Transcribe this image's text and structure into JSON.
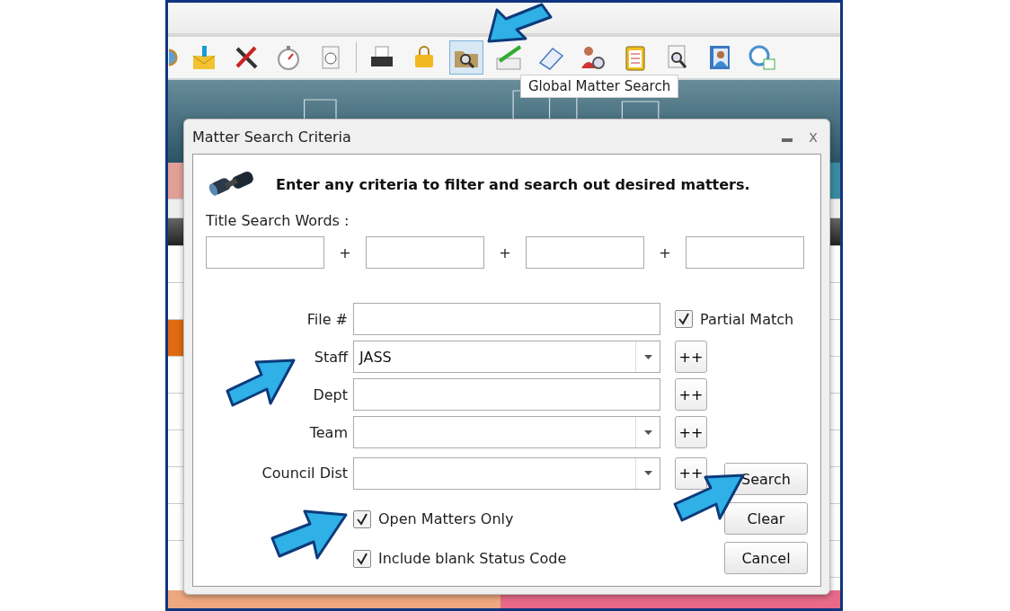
{
  "toolbar": [
    {
      "kind": "globe",
      "selected": false
    },
    {
      "kind": "mail",
      "selected": false
    },
    {
      "kind": "tools",
      "selected": false
    },
    {
      "kind": "stopwatch",
      "selected": false
    },
    {
      "kind": "clockdoc",
      "selected": false
    },
    {
      "kind": "printer",
      "selected": false
    },
    {
      "kind": "lock",
      "selected": false
    },
    {
      "kind": "foldersearch",
      "selected": true
    },
    {
      "kind": "pen",
      "selected": false
    },
    {
      "kind": "notepad",
      "selected": false
    },
    {
      "kind": "people",
      "selected": false
    },
    {
      "kind": "clipboard",
      "selected": false
    },
    {
      "kind": "docsearch",
      "selected": false
    },
    {
      "kind": "contacts",
      "selected": false
    },
    {
      "kind": "calendar",
      "selected": false
    }
  ],
  "tooltip": "Global Matter Search",
  "dialog": {
    "title": "Matter Search Criteria",
    "close": "x",
    "instruction": "Enter any criteria to filter and search out desired matters.",
    "title_search": {
      "label": "Title Search Words :",
      "joiners": [
        "+",
        "+",
        "+"
      ]
    },
    "fields": [
      {
        "kind": "text",
        "label": "File #"
      },
      {
        "kind": "dropdown",
        "label": "Staff",
        "value": "JASS",
        "add": "++"
      },
      {
        "kind": "text",
        "label": "Dept",
        "add": "++"
      },
      {
        "kind": "dropdown",
        "label": "Team",
        "add": "++"
      },
      {
        "kind": "dropdown",
        "label": "Council Dist",
        "add": "++"
      }
    ],
    "partial_match": {
      "label": "Partial Match",
      "checked": true
    },
    "options": [
      {
        "label": "Open Matters Only",
        "checked": true
      },
      {
        "label": "Include blank Status Code",
        "checked": true
      }
    ],
    "buttons": [
      "Search",
      "Clear",
      "Cancel"
    ]
  }
}
